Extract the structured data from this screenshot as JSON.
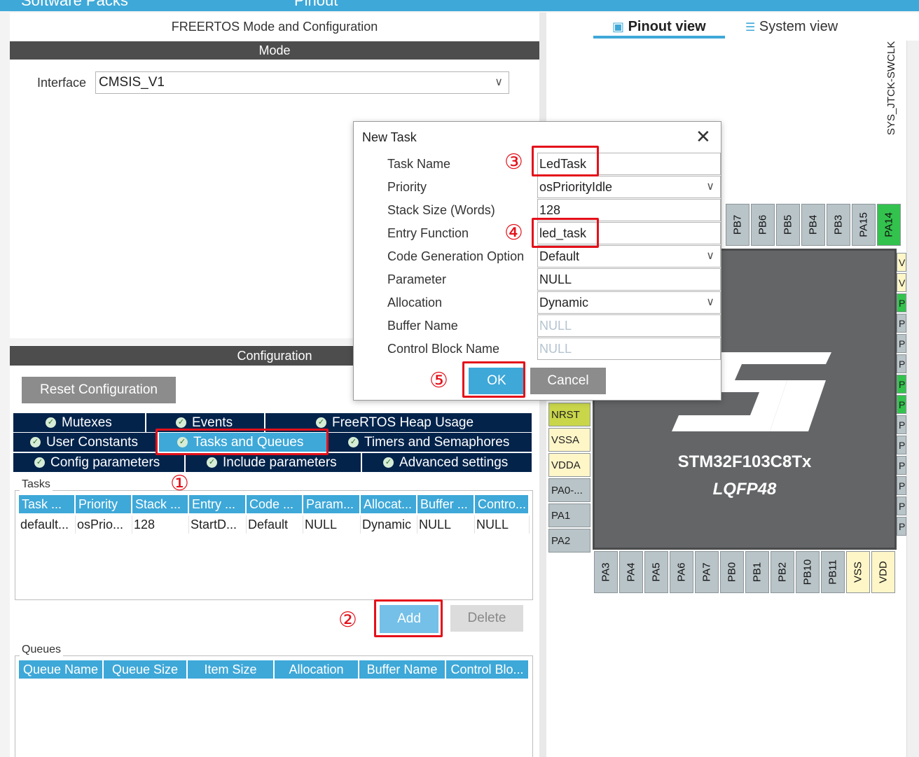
{
  "topbar": {
    "left_label": "Software Packs",
    "right_label": "Pinout"
  },
  "panel": {
    "title": "FREERTOS Mode and Configuration",
    "mode_header": "Mode",
    "interface_label": "Interface",
    "interface_value": "CMSIS_V1",
    "config_header": "Configuration",
    "reset_button": "Reset Configuration"
  },
  "tabs": {
    "mutexes": "Mutexes",
    "events": "Events",
    "heap": "FreeRTOS Heap Usage",
    "user_constants": "User Constants",
    "tasks_queues": "Tasks and Queues",
    "timers": "Timers and Semaphores",
    "config_params": "Config parameters",
    "include_params": "Include parameters",
    "advanced": "Advanced settings"
  },
  "tasks": {
    "legend": "Tasks",
    "columns": [
      "Task ...",
      "Priority",
      "Stack ...",
      "Entry ...",
      "Code ...",
      "Param...",
      "Allocat...",
      "Buffer ...",
      "Contro..."
    ],
    "row": [
      "default...",
      "osPrio...",
      "128",
      "StartD...",
      "Default",
      "NULL",
      "Dynamic",
      "NULL",
      "NULL"
    ],
    "add": "Add",
    "delete": "Delete"
  },
  "queues": {
    "legend": "Queues",
    "columns": [
      "Queue Name",
      "Queue Size",
      "Item Size",
      "Allocation",
      "Buffer Name",
      "Control Blo..."
    ]
  },
  "views": {
    "pinout": "Pinout view",
    "system": "System view"
  },
  "chip": {
    "name": "STM32F103C8Tx",
    "package": "LQFP48",
    "side_label": "SYS_JTCK-SWCLK",
    "top_pins": [
      "PB7",
      "PB6",
      "PB5",
      "PB4",
      "PB3",
      "PA15",
      "PA14"
    ],
    "left_pins": [
      "NRST",
      "VSSA",
      "VDDA",
      "PA0-...",
      "PA1",
      "PA2"
    ],
    "bottom_pins": [
      "PA3",
      "PA4",
      "PA5",
      "PA6",
      "PA7",
      "PB0",
      "PB1",
      "PB2",
      "PB10",
      "PB11",
      "VSS",
      "VDD"
    ],
    "right_pins": [
      "V",
      "V",
      "P",
      "P",
      "P",
      "P",
      "P",
      "P",
      "P",
      "P",
      "P",
      "P",
      "P",
      "P"
    ]
  },
  "dialog": {
    "title": "New Task",
    "labels": [
      "Task Name",
      "Priority",
      "Stack Size (Words)",
      "Entry Function",
      "Code Generation Option",
      "Parameter",
      "Allocation",
      "Buffer Name",
      "Control Block Name"
    ],
    "values": [
      "LedTask",
      "osPriorityIdle",
      "128",
      "led_task",
      "Default",
      "NULL",
      "Dynamic",
      "NULL",
      "NULL"
    ],
    "ok": "OK",
    "cancel": "Cancel"
  },
  "annotations": [
    "①",
    "②",
    "③",
    "④",
    "⑤"
  ],
  "colors": {
    "accent": "#3ea8d8",
    "navy": "#03234b",
    "highlight": "#e4101a",
    "pin_green": "#33c24d",
    "pin_yellow": "#fff6c8",
    "pin_olive": "#c9d64a"
  }
}
